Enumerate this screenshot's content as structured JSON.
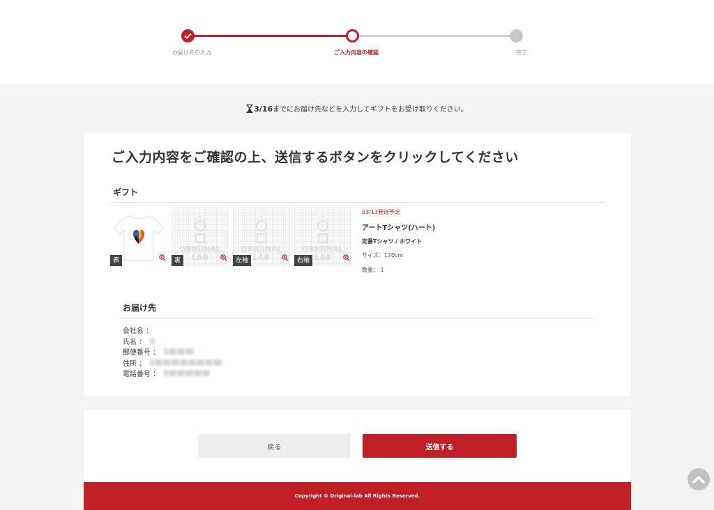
{
  "stepper": {
    "steps": [
      {
        "label": "お届け先の入力",
        "state": "done"
      },
      {
        "label": "ご入力内容の確認",
        "state": "current"
      },
      {
        "label": "完了",
        "state": "todo"
      }
    ]
  },
  "deadline": {
    "date": "3/16",
    "text": "までにお届け先などを入力してギフトをお受け取りください。"
  },
  "page_title": "ご入力内容をご確認の上、送信するボタンをクリックしてください",
  "gift": {
    "section_title": "ギフト",
    "thumbnails": [
      {
        "tag": "表"
      },
      {
        "tag": "裏"
      },
      {
        "tag": "左袖"
      },
      {
        "tag": "右袖"
      }
    ],
    "placeholder_text": [
      "ORIGINAL",
      "LAB"
    ],
    "ship_date": "03/13発送予定",
    "product_name": "アートTシャツ(ハート)",
    "variant": "定番Tシャツ / ホワイト",
    "size": "サイズ：120cm",
    "quantity": "数量： 1"
  },
  "address": {
    "section_title": "お届け先",
    "rows": [
      {
        "label": "会社名 ："
      },
      {
        "label": "氏名 ："
      },
      {
        "label": "郵便番号 ："
      },
      {
        "label": "住所 ："
      },
      {
        "label": "電話番号 ："
      }
    ]
  },
  "actions": {
    "back_label": "戻る",
    "submit_label": "送信する"
  },
  "footer": {
    "copyright": "Copyright © Original-lab All Rights Reserved."
  },
  "colors": {
    "accent": "#bf1f25",
    "background": "#f3f3f3",
    "inactive": "#c8c8c8"
  },
  "icons": [
    "check-icon",
    "hourglass-icon",
    "zoom-in-icon",
    "chevron-up-icon"
  ]
}
